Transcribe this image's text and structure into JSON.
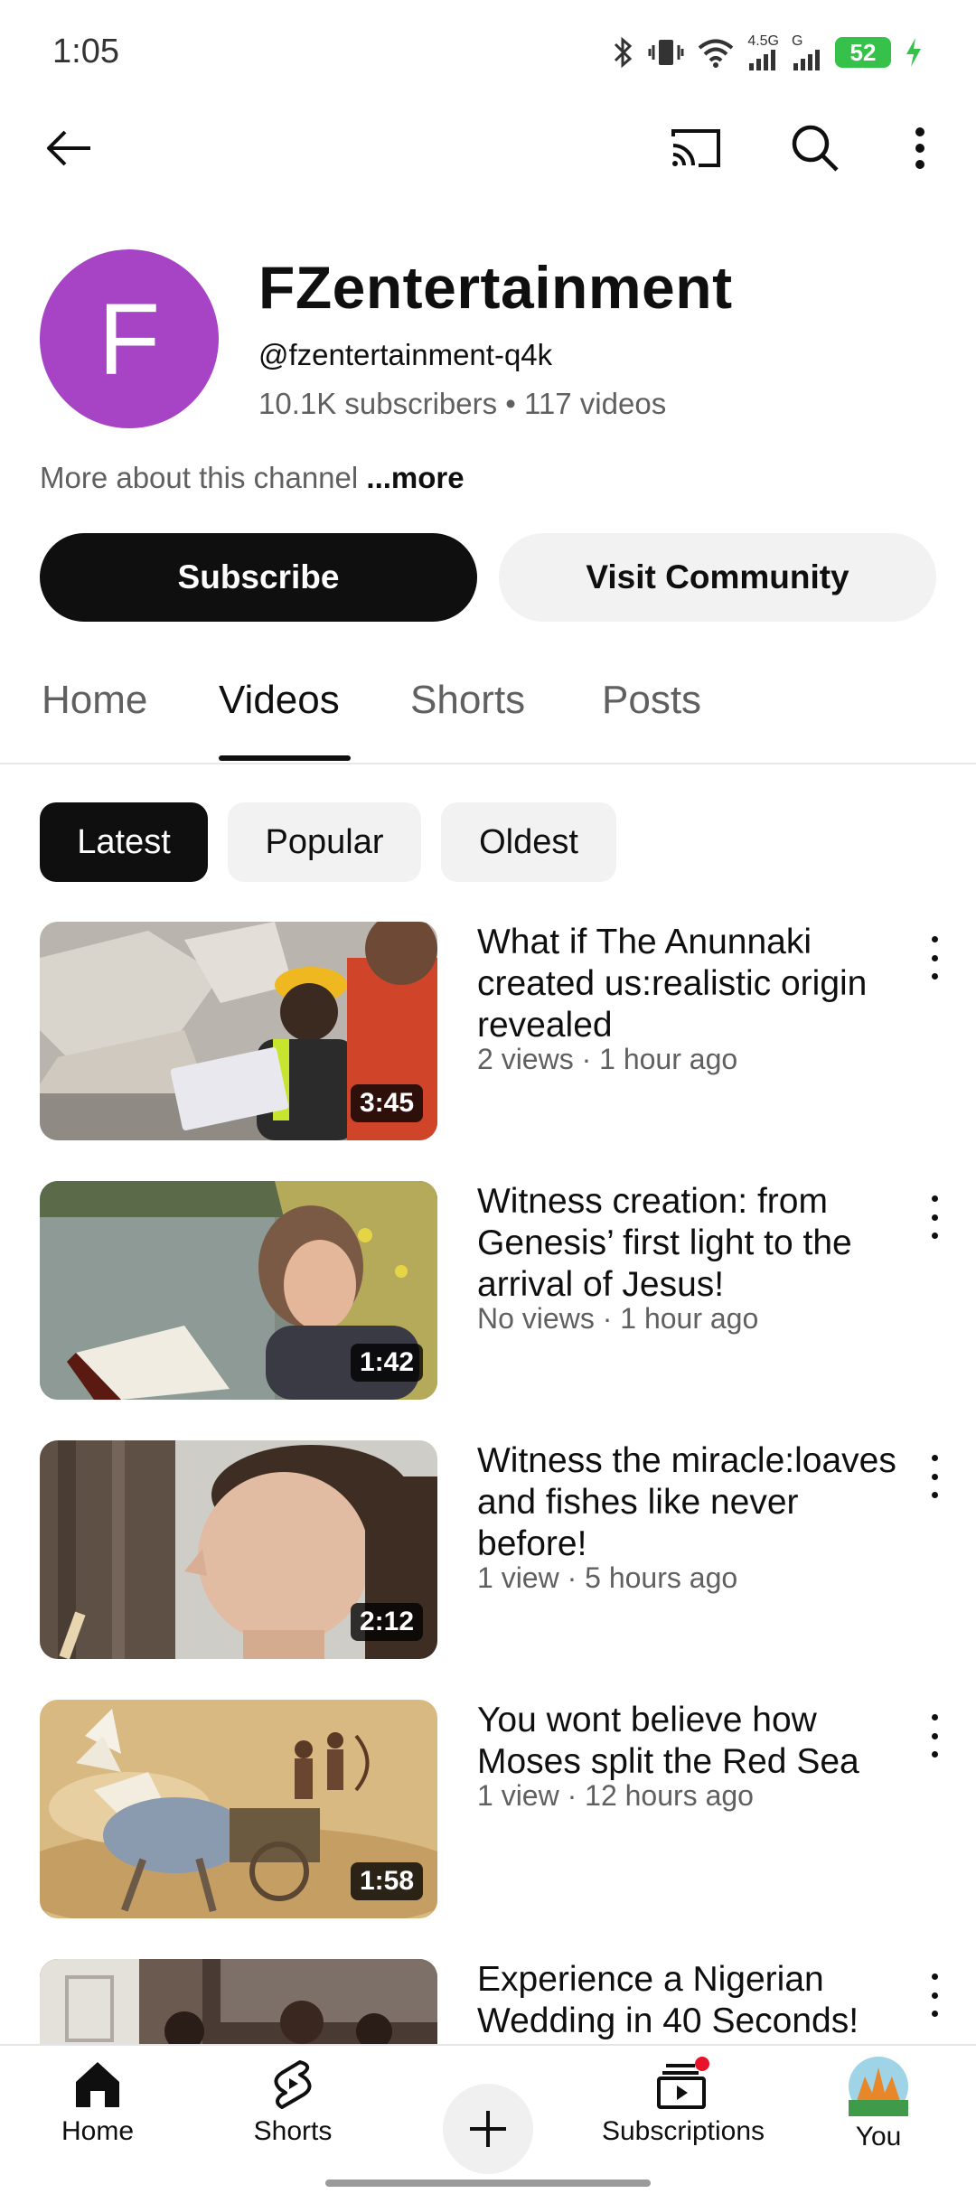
{
  "status_bar": {
    "time": "1:05",
    "network_4g": "4.5G",
    "network_g": "G",
    "battery": "52"
  },
  "channel": {
    "avatar_letter": "F",
    "name": "FZentertainment",
    "handle": "@fzentertainment-q4k",
    "stats": "10.1K subscribers • 117 videos",
    "about": "More about this channel",
    "more_link": "...more",
    "subscribe_label": "Subscribe",
    "community_label": "Visit Community",
    "avatar_color": "#a744c6"
  },
  "tabs": [
    {
      "label": "Home",
      "active": false
    },
    {
      "label": "Videos",
      "active": true
    },
    {
      "label": "Shorts",
      "active": false
    },
    {
      "label": "Posts",
      "active": false
    }
  ],
  "filters": [
    {
      "label": "Latest",
      "active": true
    },
    {
      "label": "Popular",
      "active": false
    },
    {
      "label": "Oldest",
      "active": false
    }
  ],
  "videos": [
    {
      "title": "What if The Anunnaki created us:realistic origin revealed",
      "meta": "2 views · 1 hour ago",
      "duration": "3:45"
    },
    {
      "title": "Witness creation: from Genesis’ first light to the arrival of Jesus!",
      "meta": "No views · 1 hour ago",
      "duration": "1:42"
    },
    {
      "title": "Witness the miracle:loaves and fishes like never before!",
      "meta": "1 view · 5 hours ago",
      "duration": "2:12"
    },
    {
      "title": "You wont believe how Moses split the Red Sea",
      "meta": "1 view · 12 hours ago",
      "duration": "1:58"
    },
    {
      "title": "Experience a Nigerian Wedding in 40 Seconds!",
      "meta": "",
      "duration": ""
    }
  ],
  "bottom_nav": [
    {
      "label": "Home",
      "icon": "home-icon"
    },
    {
      "label": "Shorts",
      "icon": "shorts-icon"
    },
    {
      "label": "Subscriptions",
      "icon": "subscriptions-icon"
    },
    {
      "label": "You",
      "icon": "avatar"
    }
  ]
}
